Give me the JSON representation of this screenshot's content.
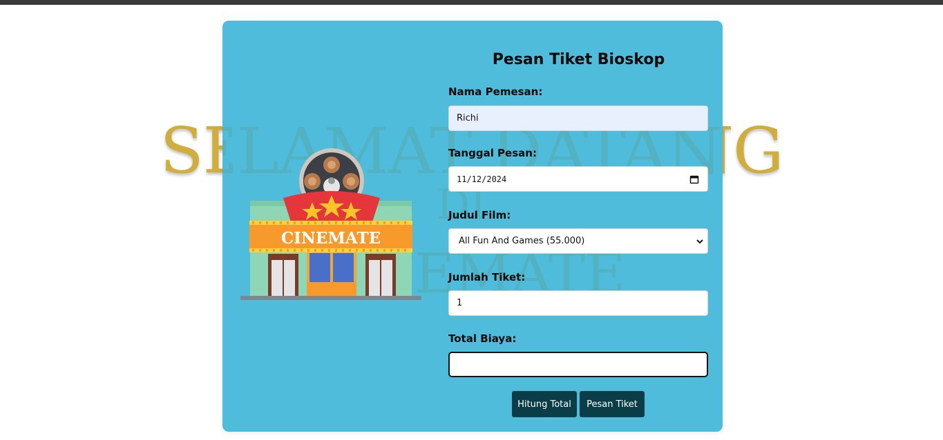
{
  "background": {
    "line1": "SELAMAT DATANG",
    "line2": "DI",
    "line3": "CINEMATE"
  },
  "logo": {
    "sign": "CINEMATE"
  },
  "form": {
    "title": "Pesan Tiket Bioskop",
    "name_label": "Nama Pemesan:",
    "name_value": "Richi",
    "date_label": "Tanggal Pesan:",
    "date_value": "11/12/2024",
    "film_label": "Judul Film:",
    "film_value": "All Fun And Games (55.000)",
    "qty_label": "Jumlah Tiket:",
    "qty_value": "1",
    "total_label": "Total Biaya:",
    "total_value": "",
    "calc_button": "Hitung Total",
    "order_button": "Pesan Tiket"
  },
  "colors": {
    "card": "#4fbcdb",
    "button": "#0b3d49",
    "headline": "#cfae3e"
  },
  "icons": {
    "date": "calendar-icon",
    "select": "chevron-down-icon"
  }
}
